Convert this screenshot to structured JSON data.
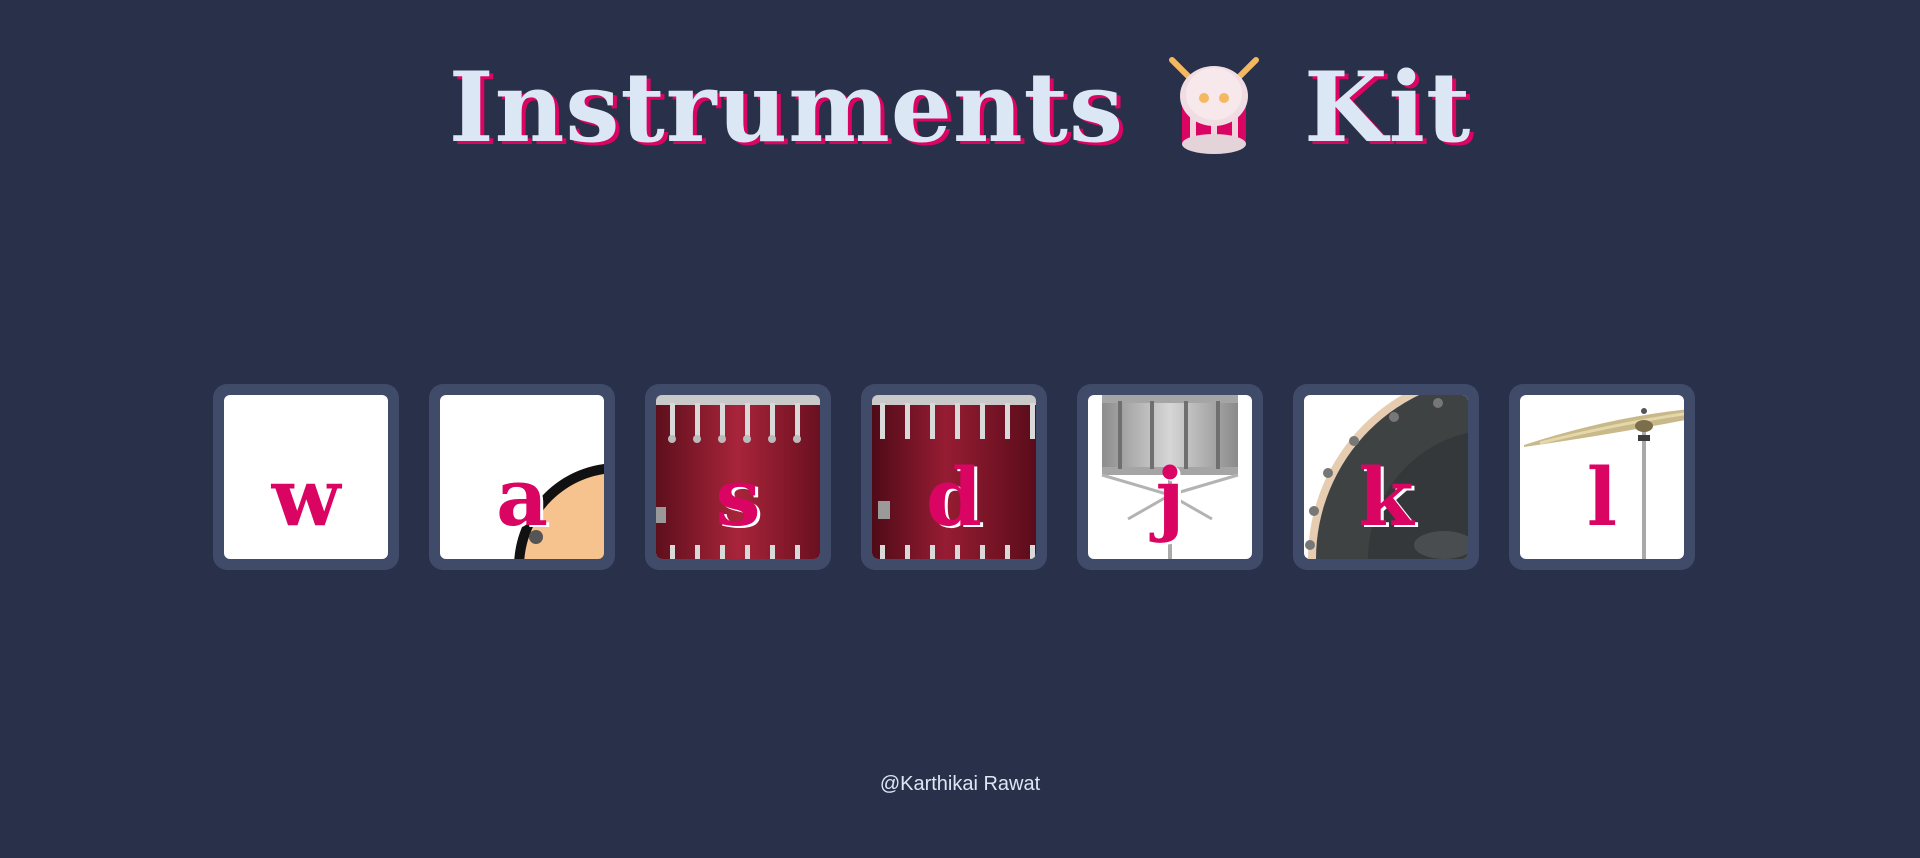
{
  "header": {
    "title_part1": "Instruments",
    "title_icon": "drum-icon",
    "title_part2": "Kit"
  },
  "keys": [
    {
      "letter": "w",
      "instrument_icon": "blank"
    },
    {
      "letter": "a",
      "instrument_icon": "tambourine-icon"
    },
    {
      "letter": "s",
      "instrument_icon": "tom-drum-icon"
    },
    {
      "letter": "d",
      "instrument_icon": "floor-tom-icon"
    },
    {
      "letter": "j",
      "instrument_icon": "snare-drum-icon"
    },
    {
      "letter": "k",
      "instrument_icon": "bass-drum-icon"
    },
    {
      "letter": "l",
      "instrument_icon": "cymbal-icon"
    }
  ],
  "footer": {
    "credit": "@Karthikai Rawat"
  },
  "colors": {
    "background": "#283149",
    "key_frame": "#404b69",
    "accent": "#da0463",
    "text": "#dbe7f4"
  }
}
